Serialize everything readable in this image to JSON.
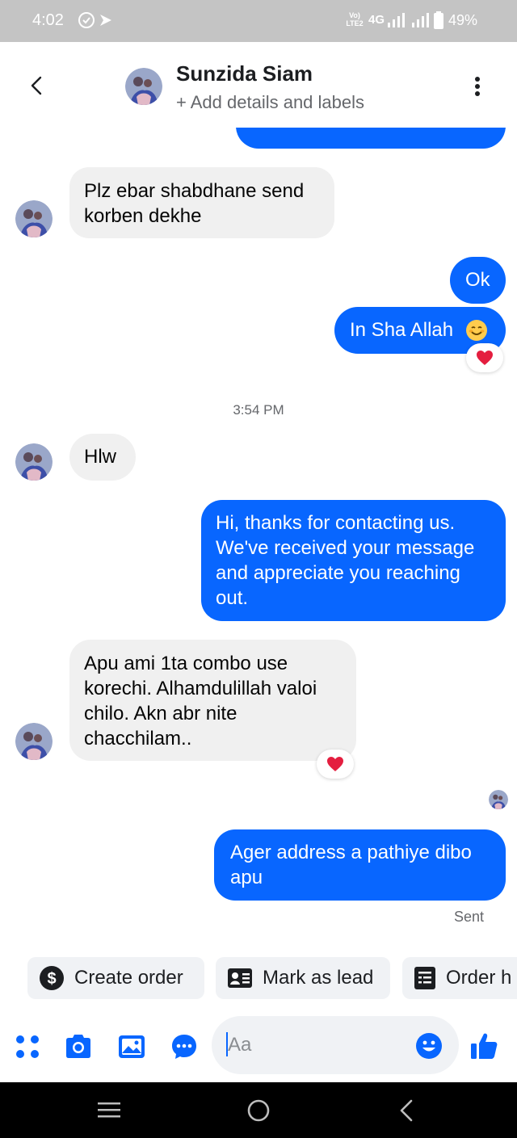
{
  "status_bar": {
    "time": "4:02",
    "volte": "Vo) LTE2",
    "network": "4G",
    "battery": "49%"
  },
  "header": {
    "contact_name": "Sunzida Siam",
    "subtitle": "+ Add details and labels",
    "back_icon": "chevron-left-icon",
    "more_icon": "more-vertical-icon"
  },
  "messages": [
    {
      "side": "in",
      "text": "Plz ebar shabdhane send korben dekhe"
    },
    {
      "side": "out",
      "text": "Ok"
    },
    {
      "side": "out",
      "text": "In Sha Allah 😊",
      "reaction": "❤️"
    },
    {
      "timestamp": "3:54 PM"
    },
    {
      "side": "in",
      "text": "Hlw"
    },
    {
      "side": "out",
      "text": "Hi, thanks for contacting us. We've received your message and appreciate you reaching out."
    },
    {
      "side": "in",
      "text": "Apu ami 1ta combo use korechi. Alhamdulillah valoi chilo. Akn abr nite chacchilam..",
      "reaction": "❤️"
    },
    {
      "side": "out",
      "text": "Ager address a pathiye dibo apu",
      "status": "Sent"
    }
  ],
  "msg_lines": {
    "m1": [
      "Plz ebar shabdhane send",
      "korben dekhe"
    ],
    "m2": [
      "Ok"
    ],
    "m3": [
      "In Sha Allah"
    ],
    "m5": [
      "Hlw"
    ],
    "m6": [
      "Hi, thanks for contacting us.",
      "We've received your message",
      "and appreciate you reaching",
      "out."
    ],
    "m7": [
      "Apu ami 1ta combo use",
      "korechi. Alhamdulillah valoi",
      "chilo. Akn abr nite",
      "chacchilam.."
    ],
    "m8": [
      "Ager address a pathiye dibo",
      "apu"
    ]
  },
  "timestamp": "3:54 PM",
  "sent_status": "Sent",
  "quick_actions": [
    {
      "label": "Create order",
      "icon": "dollar-icon"
    },
    {
      "label": "Mark as lead",
      "icon": "id-card-icon"
    },
    {
      "label": "Order h",
      "icon": "order-history-icon"
    }
  ],
  "composer": {
    "placeholder": "Aa",
    "buttons": [
      "apps-icon",
      "camera-icon",
      "image-icon",
      "chat-bubble-icon",
      "emoji-icon",
      "like-icon"
    ]
  },
  "colors": {
    "outgoing": "#0866ff",
    "incoming": "#f0f0f0",
    "status_bar": "#c4c4c4",
    "reaction": "#e41e3f"
  }
}
